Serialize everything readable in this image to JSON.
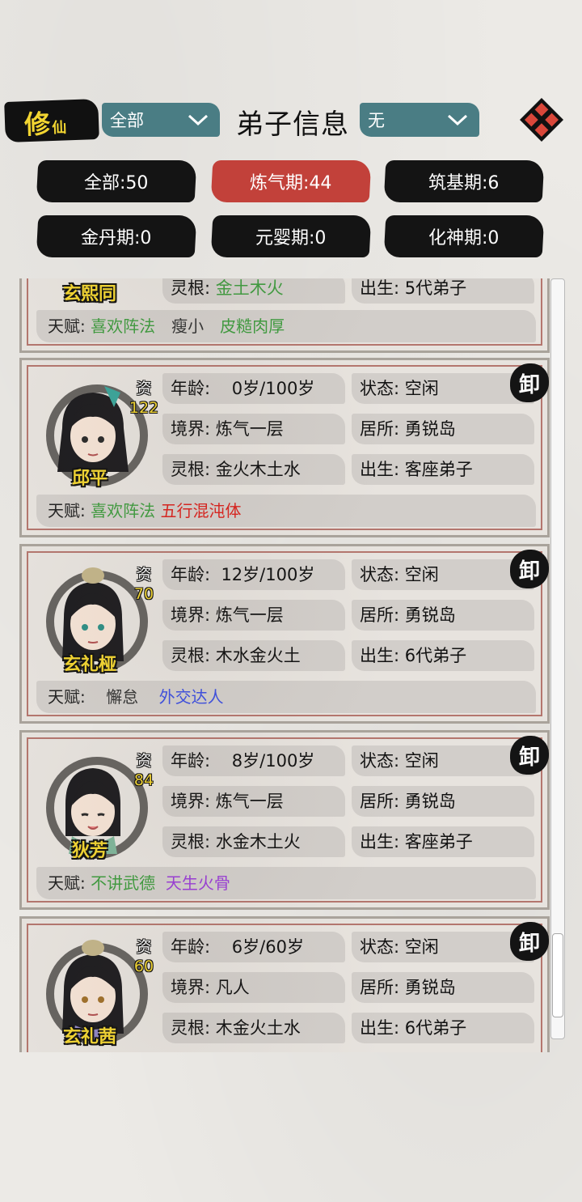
{
  "header": {
    "logo_big": "修",
    "logo_small": "仙",
    "title": "弟子信息",
    "filter_left": "全部",
    "filter_right": "无"
  },
  "tabs": [
    {
      "label": "全部:50",
      "active": false
    },
    {
      "label": "炼气期:44",
      "active": true
    },
    {
      "label": "筑基期:6",
      "active": false
    },
    {
      "label": "金丹期:0",
      "active": false
    },
    {
      "label": "元婴期:0",
      "active": false
    },
    {
      "label": "化神期:0",
      "active": false
    }
  ],
  "colors": {
    "accent_gold": "#f2d531",
    "active_tab": "#c2413a",
    "dropdown": "#4a7d84",
    "talent_green": "#3f9b3f",
    "talent_red": "#d9231e",
    "talent_blue": "#3d4fe0",
    "talent_purple": "#9a3dd6"
  },
  "labels": {
    "age": "年龄:",
    "realm": "境界:",
    "root": "灵根:",
    "status": "状态:",
    "residence": "居所:",
    "origin": "出生:",
    "talent": "天赋:",
    "aptitude": "资",
    "seal": "卸"
  },
  "disciples": [
    {
      "name": "玄熙同",
      "root": "金土木火",
      "origin": "5代弟子",
      "talents": [
        {
          "text": "喜欢阵法",
          "color": "green"
        },
        {
          "text": "瘦小",
          "color": "dark"
        },
        {
          "text": "皮糙肉厚",
          "color": "green"
        }
      ]
    },
    {
      "name": "邱平",
      "aptitude": "122",
      "age": "0岁/100岁",
      "realm": "炼气一层",
      "root": "金火木土水",
      "status": "空闲",
      "residence": "勇锐岛",
      "origin": "客座弟子",
      "talents": [
        {
          "text": "喜欢阵法",
          "color": "green"
        },
        {
          "text": "五行混沌体",
          "color": "red"
        }
      ]
    },
    {
      "name": "玄礼桠",
      "aptitude": "70",
      "age": "12岁/100岁",
      "realm": "炼气一层",
      "root": "木水金火土",
      "status": "空闲",
      "residence": "勇锐岛",
      "origin": "6代弟子",
      "talents": [
        {
          "text": "懈怠",
          "color": "dark"
        },
        {
          "text": "外交达人",
          "color": "blue"
        }
      ]
    },
    {
      "name": "狄芳",
      "aptitude": "84",
      "age": "8岁/100岁",
      "realm": "炼气一层",
      "root": "水金木土火",
      "status": "空闲",
      "residence": "勇锐岛",
      "origin": "客座弟子",
      "talents": [
        {
          "text": "不讲武德",
          "color": "green"
        },
        {
          "text": "天生火骨",
          "color": "purple"
        }
      ]
    },
    {
      "name": "玄礼茜",
      "aptitude": "60",
      "age": "6岁/60岁",
      "realm": "凡人",
      "root": "木金火土水",
      "status": "空闲",
      "residence": "勇锐岛",
      "origin": "6代弟子"
    }
  ]
}
